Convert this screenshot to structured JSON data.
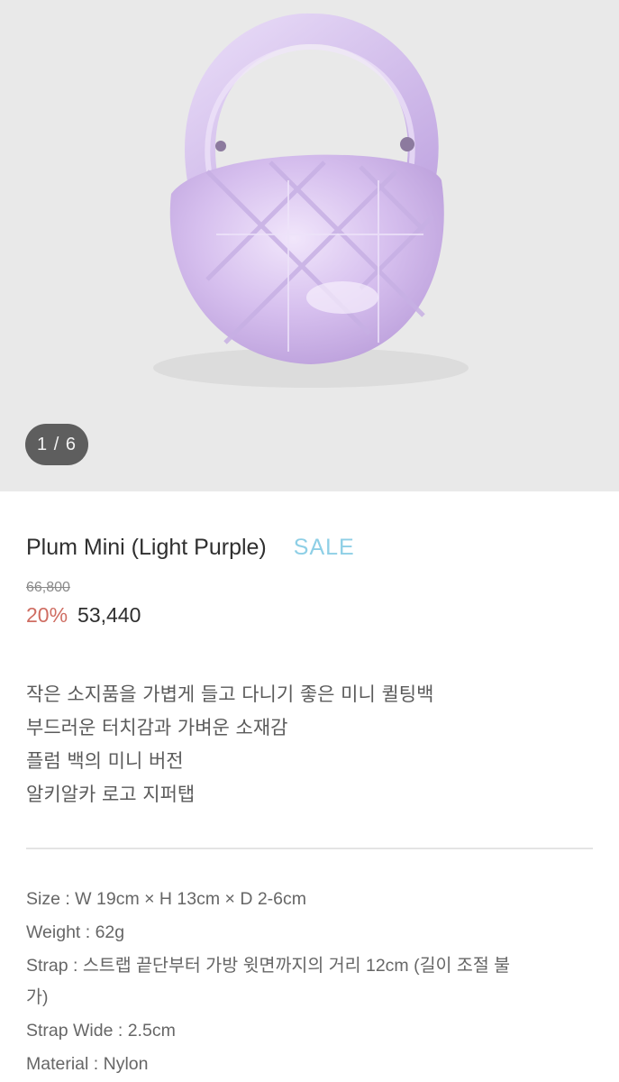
{
  "gallery": {
    "counter": "1 / 6",
    "image_alt": "light purple quilted mini bag"
  },
  "product": {
    "name": "Plum Mini (Light Purple)",
    "badge": "SALE",
    "original_price": "66,800",
    "discount": "20%",
    "price": "53,440"
  },
  "description": [
    "작은 소지품을 가볍게 들고 다니기 좋은 미니 퀼팅백",
    "부드러운 터치감과 가벼운 소재감",
    "플럼 백의 미니 버전",
    "알키알카 로고 지퍼탭"
  ],
  "specs": {
    "size": "Size : W 19cm × H 13cm × D 2-6cm",
    "weight": "Weight : 62g",
    "strap": "Strap : 스트랩 끝단부터 가방 윗면까지의 거리 12cm (길이 조절 불",
    "strap_cont": "가)",
    "strap_wide": "Strap Wide : 2.5cm",
    "material": "Material : Nylon"
  },
  "colors": {
    "badge": "#8ecfe6",
    "discount": "#cf6d62",
    "bag": "#d8c3ee"
  }
}
